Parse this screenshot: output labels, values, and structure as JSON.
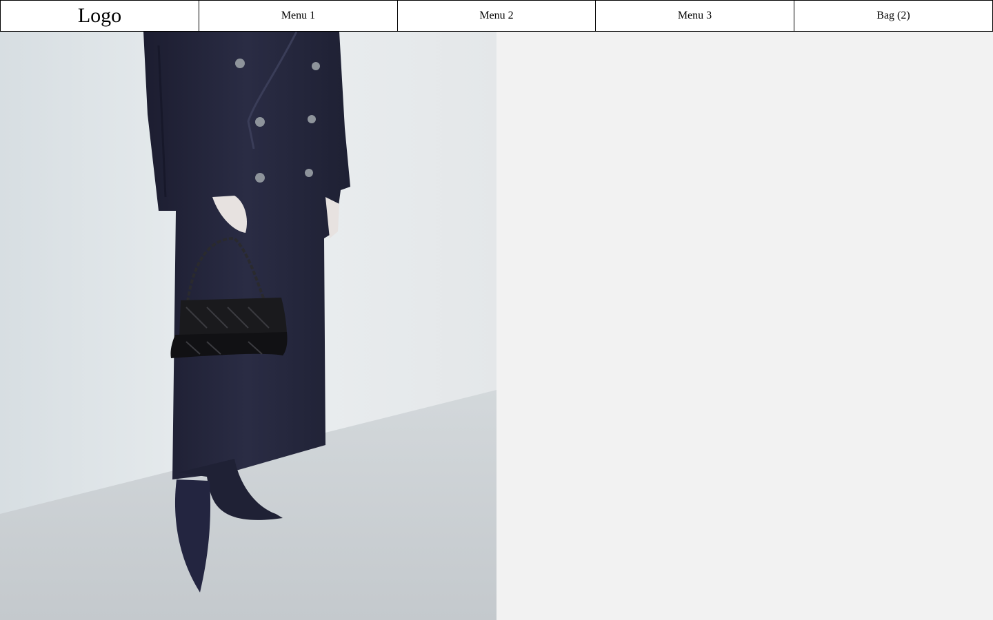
{
  "header": {
    "logo": "Logo",
    "menu": [
      {
        "label": "Menu 1"
      },
      {
        "label": "Menu 2"
      },
      {
        "label": "Menu 3"
      }
    ],
    "bag_label": "Bag (2)"
  },
  "hero": {
    "image_subject": "model in long navy double-breasted coat holding black quilted handbag, pointed navy boots",
    "right_panel_color": "#f2f2f2"
  },
  "colors": {
    "border": "#000000",
    "background": "#ffffff",
    "coat": "#23253a",
    "wall": "#e2e7ea",
    "floor": "#c9ced2"
  }
}
